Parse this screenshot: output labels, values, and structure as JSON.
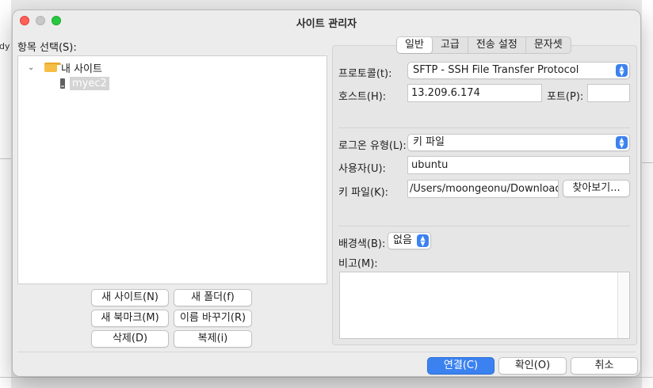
{
  "background_app": {
    "left_text": "dy"
  },
  "window": {
    "title": "사이트 관리자"
  },
  "left": {
    "entry_label": "항목 선택(S):",
    "tree": {
      "root_label": "내 사이트",
      "site_label": "myec2"
    },
    "buttons": {
      "new_site": "새 사이트(N)",
      "new_folder": "새 폴더(f)",
      "new_bookmark": "새 북마크(M)",
      "rename": "이름 바꾸기(R)",
      "delete": "삭제(D)",
      "duplicate": "복제(i)"
    }
  },
  "tabs": [
    {
      "label": "일반",
      "active": true
    },
    {
      "label": "고급",
      "active": false
    },
    {
      "label": "전송 설정",
      "active": false
    },
    {
      "label": "문자셋",
      "active": false
    }
  ],
  "general": {
    "protocol_label": "프로토콜(t):",
    "protocol_value": "SFTP - SSH File Transfer Protocol",
    "host_label": "호스트(H):",
    "host_value": "13.209.6.174",
    "port_label": "포트(P):",
    "port_value": "",
    "logon_type_label": "로그온 유형(L):",
    "logon_type_value": "키 파일",
    "user_label": "사용자(U):",
    "user_value": "ubuntu",
    "keyfile_label": "키 파일(K):",
    "keyfile_value": "/Users/moongeonu/Downloads",
    "browse_button": "찾아보기...",
    "bgcolor_label": "배경색(B):",
    "bgcolor_value": "없음",
    "comments_label": "비고(M):",
    "comments_value": ""
  },
  "footer": {
    "connect": "연결(C)",
    "ok": "확인(O)",
    "cancel": "취소"
  },
  "colors": {
    "accent": "#3b82f0",
    "folder": "#f6be45",
    "close": "#fe5f57",
    "zoom": "#28c840"
  }
}
